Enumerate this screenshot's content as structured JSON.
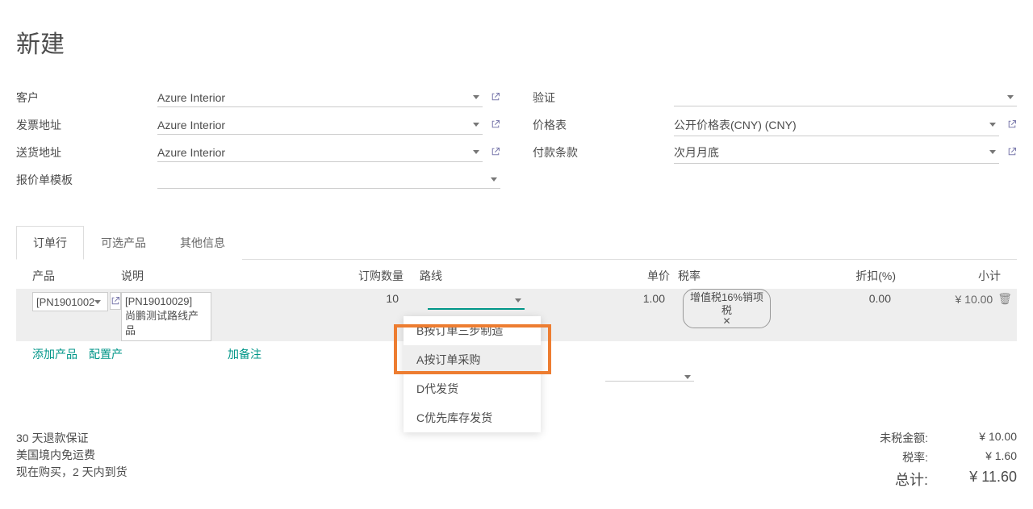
{
  "header": {
    "title": "新建"
  },
  "form": {
    "left": {
      "customer": {
        "label": "客户",
        "value": "Azure Interior"
      },
      "invoice_addr": {
        "label": "发票地址",
        "value": "Azure Interior"
      },
      "delivery_addr": {
        "label": "送货地址",
        "value": "Azure Interior"
      },
      "quote_template": {
        "label": "报价单模板",
        "value": ""
      }
    },
    "right": {
      "validate": {
        "label": "验证",
        "value": ""
      },
      "pricelist": {
        "label": "价格表",
        "value": "公开价格表(CNY) (CNY)"
      },
      "payment_terms": {
        "label": "付款条款",
        "value": "次月月底"
      }
    }
  },
  "tabs": {
    "order_lines": "订单行",
    "optional": "可选产品",
    "other_info": "其他信息"
  },
  "table": {
    "headers": {
      "product": "产品",
      "desc": "说明",
      "qty": "订购数量",
      "route": "路线",
      "price": "单价",
      "tax": "税率",
      "discount": "折扣(%)",
      "subtotal": "小计"
    },
    "row": {
      "product": "[PN1901002",
      "desc_line1": "[PN19010029]",
      "desc_line2": "尚鹏测试路线产品",
      "qty": "10",
      "price": "1.00",
      "tax_line1": "增值税16%销项",
      "tax_line2": "税",
      "discount": "0.00",
      "subtotal": "¥ 10.00"
    },
    "actions": {
      "add_product": "添加产品",
      "configure": "配置产",
      "add_note": "加备注"
    },
    "route_options": {
      "opt_b": "B按订单三步制造",
      "opt_a": "A按订单采购",
      "opt_d": "D代发货",
      "opt_c": "C优先库存发货"
    }
  },
  "footer": {
    "left": {
      "l1": "30 天退款保证",
      "l2": "美国境内免运费",
      "l3": "现在购买，2 天内到货"
    },
    "right": {
      "untaxed": {
        "label": "未税金额:",
        "value": "¥ 10.00"
      },
      "tax": {
        "label": "税率:",
        "value": "¥ 1.60"
      },
      "total": {
        "label": "总计:",
        "value": "¥ 11.60"
      }
    }
  }
}
